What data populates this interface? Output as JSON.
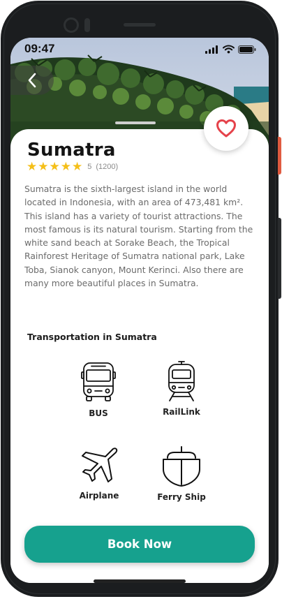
{
  "status_bar": {
    "time": "09:47"
  },
  "colors": {
    "accent": "#16a18e",
    "star": "#f5bf18",
    "heart": "#e5424a"
  },
  "destination": {
    "name": "Sumatra",
    "rating_value": "5",
    "rating_count": "(1200)",
    "stars": "★★★★★",
    "description": "Sumatra is the sixth-largest island in the world located in Indonesia, with an area of 473,481 km². This island has a variety of tourist attractions. The most famous is its natural tourism. Starting from the white sand beach at Sorake Beach, the Tropical Rainforest Heritage of Sumatra national park, Lake Toba, Sianok canyon, Mount Kerinci. Also there are many more beautiful places in Sumatra."
  },
  "transportation": {
    "title": "Transportation in Sumatra",
    "options": [
      {
        "label": "BUS",
        "icon": "bus-icon"
      },
      {
        "label": "RailLink",
        "icon": "train-icon"
      },
      {
        "label": "Airplane",
        "icon": "airplane-icon"
      },
      {
        "label": "Ferry Ship",
        "icon": "ship-icon"
      }
    ]
  },
  "actions": {
    "book_label": "Book Now"
  }
}
